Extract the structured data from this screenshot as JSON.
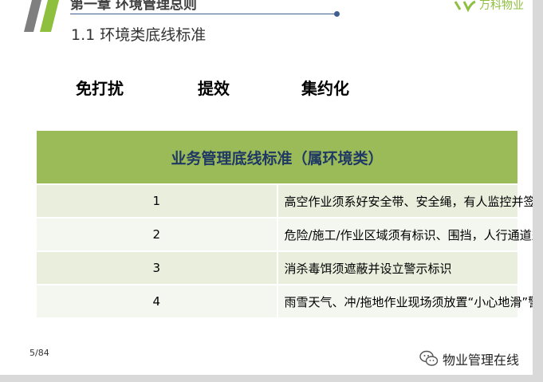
{
  "header": {
    "chapter_title": "第一章  环境管理总则",
    "section_title": "1.1 环境类底线标准",
    "logo_text": "万科物业"
  },
  "keywords": [
    "免打扰",
    "提效",
    "集约化"
  ],
  "table": {
    "title": "业务管理底线标准（属环境类）",
    "rows": [
      {
        "num": "1",
        "text": "高空作业须系好安全带、安全绳，有人监控并签订安全生产责任书"
      },
      {
        "num": "2",
        "text": "危险/施工/作业区域须有标识、围挡，人行通道须平整"
      },
      {
        "num": "3",
        "text": "消杀毒饵须遮蔽并设立警示标识"
      },
      {
        "num": "4",
        "text": "雨雪天气、冲/拖地作业现场须放置“小心地滑”警示标识"
      }
    ]
  },
  "footer": {
    "page_number": "5/84",
    "watermark": "物业管理在线"
  },
  "colors": {
    "accent_green": "#9bbb59",
    "header_text_navy": "#1f3864",
    "chevron_gray": "#7f7f7f",
    "chevron_green": "#8fbf3f"
  },
  "icons": [
    "chevron-logo-icon",
    "vanke-logo-icon",
    "wechat-icon"
  ]
}
